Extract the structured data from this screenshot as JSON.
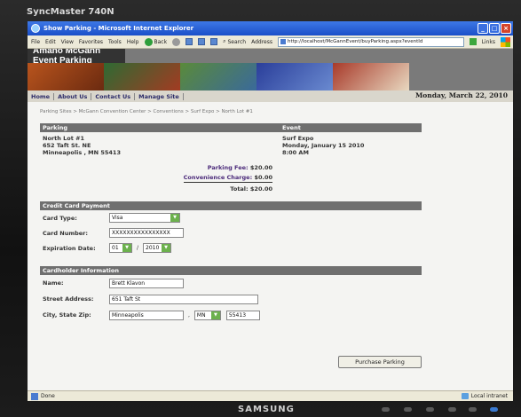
{
  "monitor": {
    "brand": "SyncMaster 740N",
    "maker": "SAMSUNG"
  },
  "browser": {
    "title": "Show Parking - Microsoft Internet Explorer",
    "menu": [
      "File",
      "Edit",
      "View",
      "Favorites",
      "Tools",
      "Help"
    ],
    "back_label": "Back",
    "search_label": "Search",
    "address_label": "Address",
    "url": "http://localhost/McGannEvent/buyParking.aspx?eventId",
    "links_label": "Links",
    "status_text": "Done",
    "zone_text": "Local intranet"
  },
  "site": {
    "logo": "Amano McGann Event Parking",
    "nav": [
      "Home",
      "About Us",
      "Contact Us",
      "Manage Site"
    ],
    "date": "Monday, March 22, 2010",
    "breadcrumb": "Parking Sites > McGann Convention Center > Conventions > Surf Expo > North Lot #1"
  },
  "parking": {
    "section_label": "Parking",
    "lot_name": "North Lot #1",
    "street": "652 Taft St. NE",
    "city_line": "Minneapolis , MN 55413",
    "parking_fee_label": "Parking Fee:",
    "parking_fee": "$20.00",
    "convenience_label": "Convenience Charge:",
    "convenience": "$0.00",
    "total_label": "Total:",
    "total": "$20.00"
  },
  "event": {
    "section_label": "Event",
    "name": "Surf Expo",
    "date": "Monday, January 15 2010",
    "time": "8:00 AM"
  },
  "credit_card": {
    "section_label": "Credit Card Payment",
    "card_type_label": "Card Type:",
    "card_type": "Visa",
    "card_number_label": "Card Number:",
    "card_number": "XXXXXXXXXXXXXXXX",
    "expiration_label": "Expiration Date:",
    "exp_month": "01",
    "exp_year": "2010",
    "separator": "/"
  },
  "cardholder": {
    "section_label": "Cardholder Information",
    "name_label": "Name:",
    "name": "Brett Klavon",
    "street_label": "Street Address:",
    "street": "651 Taft St",
    "csz_label": "City, State Zip:",
    "city": "Minneapolis",
    "comma": ",",
    "state": "MN",
    "zip": "55413"
  },
  "actions": {
    "purchase_label": "Purchase Parking"
  }
}
